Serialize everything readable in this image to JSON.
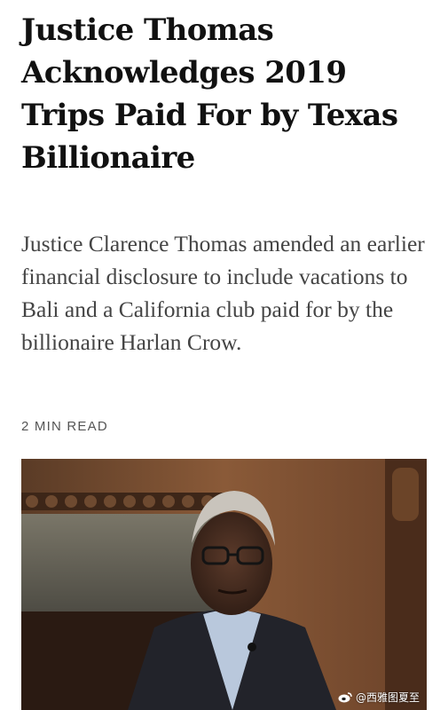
{
  "article": {
    "headline": "Justice Thomas Acknowledges 2019 Trips Paid For by Texas Billionaire",
    "summary": "Justice Clarence Thomas amended an earlier financial disclosure to include vacations to Bali and a California club paid for by the billionaire Harlan Crow.",
    "read_time": "2 MIN READ"
  },
  "photo": {
    "icon": "portrait-photo"
  },
  "watermark": {
    "icon": "weibo-icon",
    "text": "@西雅图夏至"
  },
  "colors": {
    "headline": "#111111",
    "summary": "#444444",
    "meta": "#555555",
    "background": "#ffffff"
  }
}
